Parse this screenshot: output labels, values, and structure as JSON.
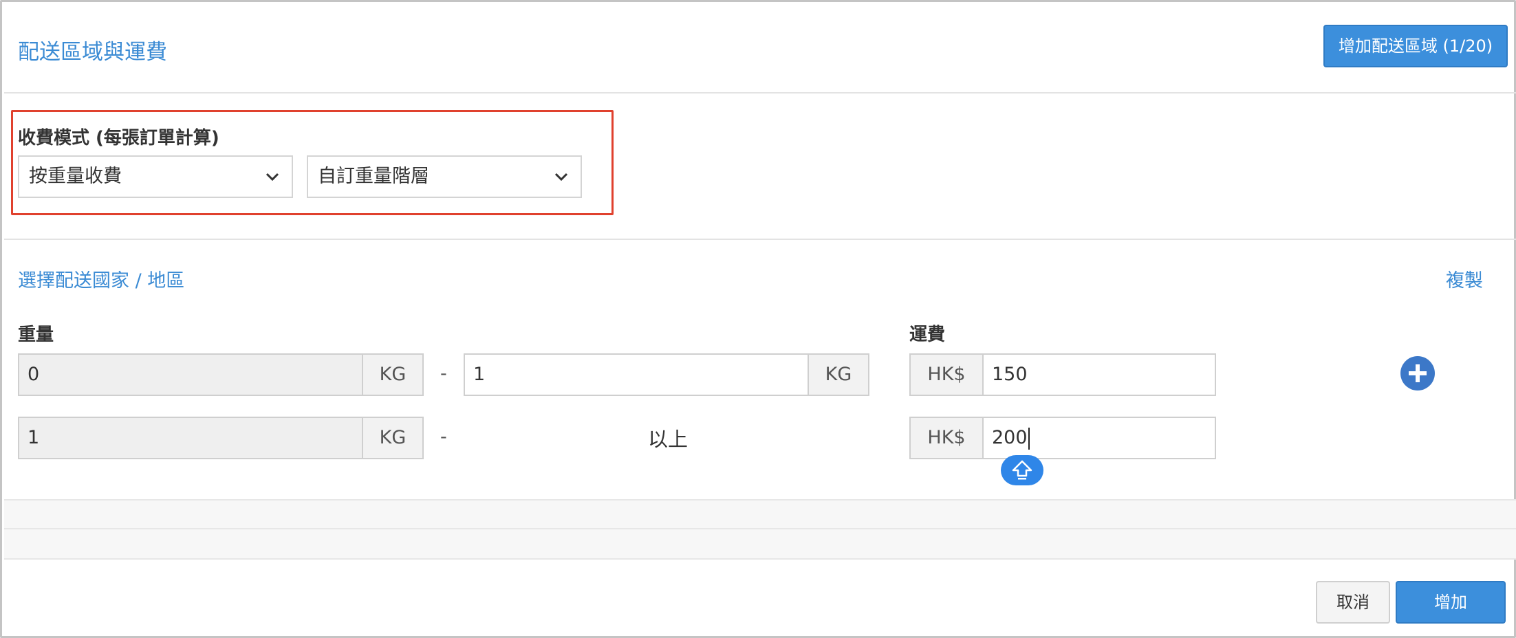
{
  "header": {
    "title": "配送區域與運費",
    "add_region_label": "增加配送區域 (1/20)"
  },
  "mode": {
    "label": "收費模式 (每張訂單計算)",
    "charge_by": "按重量收費",
    "tier_type": "自訂重量階層"
  },
  "rates": {
    "choose_region_link": "選擇配送國家 / 地區",
    "copy_link": "複製",
    "weight_header": "重量",
    "fee_header": "運費",
    "unit": "KG",
    "dash": "-",
    "currency": "HK$",
    "above_label": "以上",
    "rows": [
      {
        "from": "0",
        "to": "1",
        "fee": "150"
      },
      {
        "from": "1",
        "fee": "200"
      }
    ]
  },
  "footer": {
    "cancel_label": "取消",
    "submit_label": "增加"
  },
  "colors": {
    "accent": "#3c8fdc",
    "link": "#3b8bd4",
    "highlight_border": "#e0412e"
  },
  "icons": [
    "chevron-down-icon",
    "plus-circle-icon",
    "shift-arrow-icon"
  ]
}
